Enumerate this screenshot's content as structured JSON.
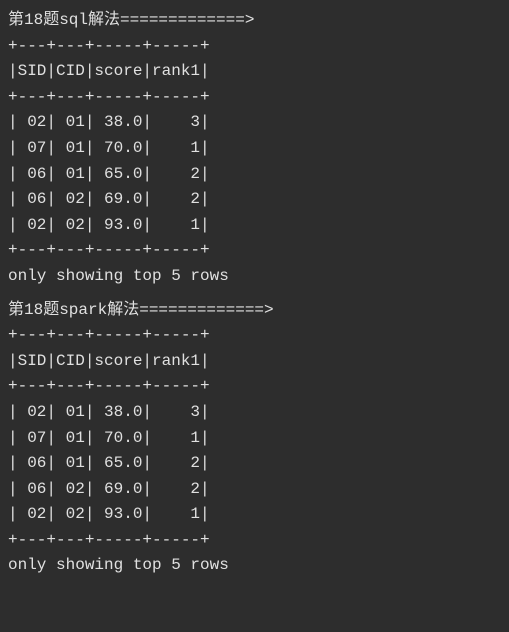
{
  "block1": {
    "header": "第18题sql解法=============>",
    "separator": "+---+---+-----+-----+",
    "columns": "|SID|CID|score|rank1|",
    "rows": [
      "| 02| 01| 38.0|    3|",
      "| 07| 01| 70.0|    1|",
      "| 06| 01| 65.0|    2|",
      "| 06| 02| 69.0|    2|",
      "| 02| 02| 93.0|    1|"
    ],
    "footer": "only showing top 5 rows"
  },
  "block2": {
    "header": "第18题spark解法=============>",
    "separator": "+---+---+-----+-----+",
    "columns": "|SID|CID|score|rank1|",
    "rows": [
      "| 02| 01| 38.0|    3|",
      "| 07| 01| 70.0|    1|",
      "| 06| 01| 65.0|    2|",
      "| 06| 02| 69.0|    2|",
      "| 02| 02| 93.0|    1|"
    ],
    "footer": "only showing top 5 rows"
  },
  "chart_data": [
    {
      "type": "table",
      "title": "第18题sql解法",
      "columns": [
        "SID",
        "CID",
        "score",
        "rank1"
      ],
      "rows": [
        [
          "02",
          "01",
          38.0,
          3
        ],
        [
          "07",
          "01",
          70.0,
          1
        ],
        [
          "06",
          "01",
          65.0,
          2
        ],
        [
          "06",
          "02",
          69.0,
          2
        ],
        [
          "02",
          "02",
          93.0,
          1
        ]
      ],
      "note": "only showing top 5 rows"
    },
    {
      "type": "table",
      "title": "第18题spark解法",
      "columns": [
        "SID",
        "CID",
        "score",
        "rank1"
      ],
      "rows": [
        [
          "02",
          "01",
          38.0,
          3
        ],
        [
          "07",
          "01",
          70.0,
          1
        ],
        [
          "06",
          "01",
          65.0,
          2
        ],
        [
          "06",
          "02",
          69.0,
          2
        ],
        [
          "02",
          "02",
          93.0,
          1
        ]
      ],
      "note": "only showing top 5 rows"
    }
  ]
}
